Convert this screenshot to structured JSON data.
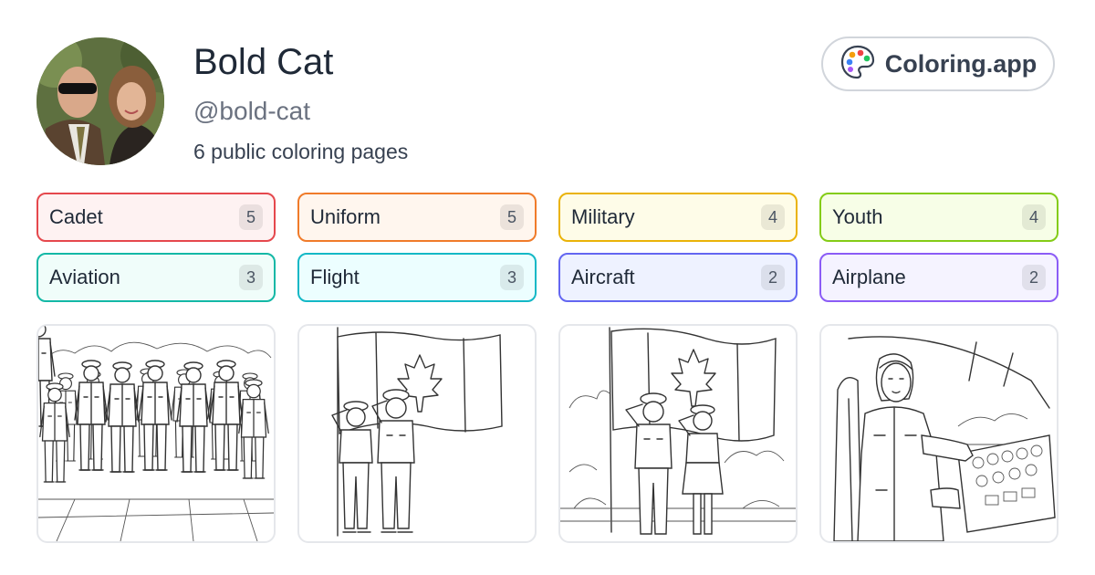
{
  "profile": {
    "name": "Bold Cat",
    "handle": "@bold-cat",
    "page_count_text": "6 public coloring pages"
  },
  "brand": {
    "label": "Coloring.app",
    "icon": "palette-icon"
  },
  "tags": [
    {
      "label": "Cadet",
      "count": "5",
      "color": "#e5484d",
      "bg": "#fef2f2"
    },
    {
      "label": "Uniform",
      "count": "5",
      "color": "#f07b2a",
      "bg": "#fff6ee"
    },
    {
      "label": "Military",
      "count": "4",
      "color": "#eab308",
      "bg": "#fefce8"
    },
    {
      "label": "Youth",
      "count": "4",
      "color": "#84cc16",
      "bg": "#f7fee7"
    },
    {
      "label": "Aviation",
      "count": "3",
      "color": "#14b8a6",
      "bg": "#f0fdfa"
    },
    {
      "label": "Flight",
      "count": "3",
      "color": "#14b8c6",
      "bg": "#ecfeff"
    },
    {
      "label": "Aircraft",
      "count": "2",
      "color": "#6366f1",
      "bg": "#eef2ff"
    },
    {
      "label": "Airplane",
      "count": "2",
      "color": "#8b5cf6",
      "bg": "#f5f3ff"
    }
  ],
  "thumbnails": [
    {
      "subject": "cadets-in-formation"
    },
    {
      "subject": "two-cadets-saluting-flag"
    },
    {
      "subject": "cadets-saluting-flag-outdoors"
    },
    {
      "subject": "pilot-in-cockpit"
    }
  ]
}
